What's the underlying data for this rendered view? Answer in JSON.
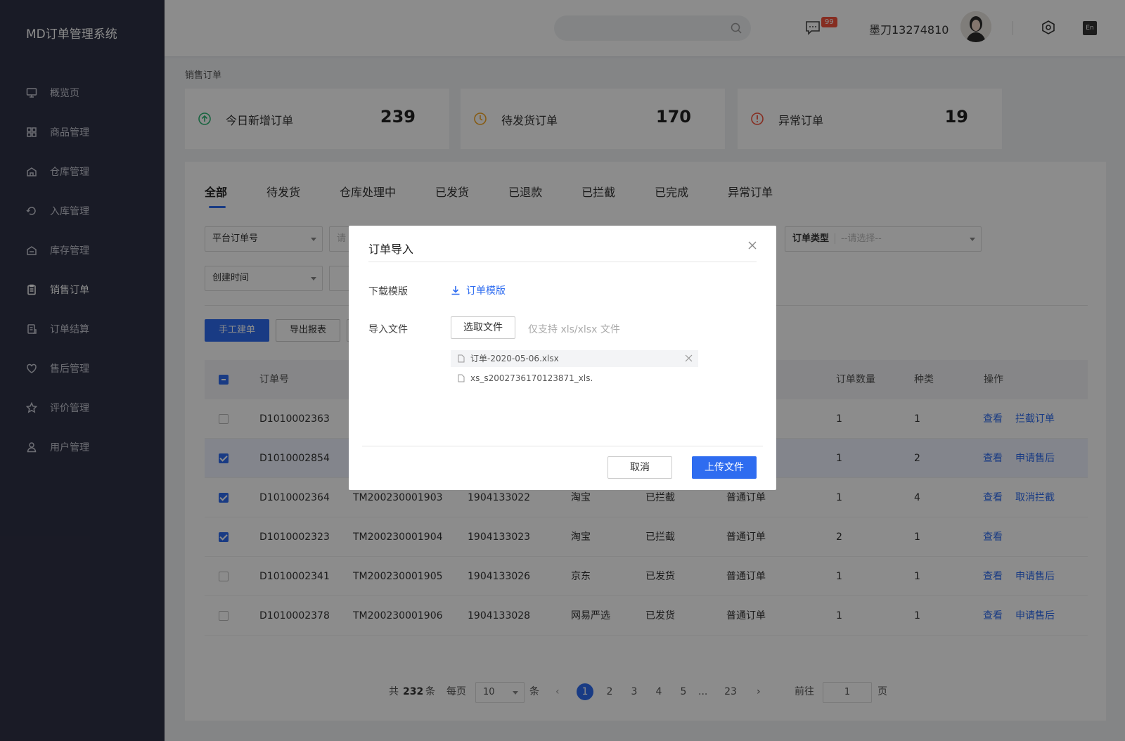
{
  "app": {
    "title": "MD订单管理系统"
  },
  "sidebar": {
    "items": [
      {
        "label": "概览页",
        "icon": "monitor-icon"
      },
      {
        "label": "商品管理",
        "icon": "grid-icon"
      },
      {
        "label": "仓库管理",
        "icon": "warehouse-icon"
      },
      {
        "label": "入库管理",
        "icon": "inbound-icon"
      },
      {
        "label": "库存管理",
        "icon": "stock-icon"
      },
      {
        "label": "销售订单",
        "icon": "clipboard-icon",
        "active": true
      },
      {
        "label": "订单结算",
        "icon": "settlement-icon"
      },
      {
        "label": "售后管理",
        "icon": "heart-icon"
      },
      {
        "label": "评价管理",
        "icon": "star-icon"
      },
      {
        "label": "用户管理",
        "icon": "user-icon"
      }
    ]
  },
  "header": {
    "message_badge": "99",
    "username": "墨刀13274810",
    "lang": "En"
  },
  "breadcrumb": "销售订单",
  "stats": [
    {
      "label": "今日新增订单",
      "value": "239",
      "icon": "arrow-up-circle-icon",
      "color": "#2bb673"
    },
    {
      "label": "待发货订单",
      "value": "170",
      "icon": "clock-icon",
      "color": "#f5a623"
    },
    {
      "label": "异常订单",
      "value": "19",
      "icon": "alert-circle-icon",
      "color": "#f5523c"
    }
  ],
  "tabs": [
    "全部",
    "待发货",
    "仓库处理中",
    "已发货",
    "已退款",
    "已拦截",
    "已完成",
    "异常订单"
  ],
  "filters": {
    "platform_order": "平台订单号",
    "placeholder_partial": "请",
    "create_time": "创建时间",
    "order_type_label": "订单类型",
    "order_type_placeholder": "--请选择--"
  },
  "actions": {
    "manual_create": "手工建单",
    "export_report": "导出报表"
  },
  "table": {
    "headers": {
      "order_no": "订单号",
      "quantity": "订单数量",
      "kind": "种类",
      "ops": "操作"
    },
    "rows": [
      {
        "checked": false,
        "order_no": "D1010002363",
        "tm": "",
        "code": "",
        "platform": "",
        "status": "",
        "type": "",
        "qty": "1",
        "kind": "1",
        "op1": "查看",
        "op2": "拦截订单"
      },
      {
        "checked": true,
        "order_no": "D1010002854",
        "tm": "",
        "code": "",
        "platform": "",
        "status": "",
        "type": "",
        "qty": "1",
        "kind": "2",
        "op1": "查看",
        "op2": "申请售后"
      },
      {
        "checked": true,
        "order_no": "D1010002364",
        "tm": "TM200230001903",
        "code": "1904133022",
        "platform": "淘宝",
        "status": "已拦截",
        "type": "普通订单",
        "qty": "1",
        "kind": "4",
        "op1": "查看",
        "op2": "取消拦截"
      },
      {
        "checked": true,
        "order_no": "D1010002323",
        "tm": "TM200230001904",
        "code": "1904133023",
        "platform": "淘宝",
        "status": "已拦截",
        "type": "普通订单",
        "qty": "2",
        "kind": "1",
        "op1": "查看",
        "op2": ""
      },
      {
        "checked": false,
        "order_no": "D1010002341",
        "tm": "TM200230001905",
        "code": "1904133026",
        "platform": "京东",
        "status": "已发货",
        "type": "普通订单",
        "qty": "1",
        "kind": "1",
        "op1": "查看",
        "op2": "申请售后"
      },
      {
        "checked": false,
        "order_no": "D1010002378",
        "tm": "TM200230001906",
        "code": "1904133028",
        "platform": "网易严选",
        "status": "已发货",
        "type": "普通订单",
        "qty": "1",
        "kind": "1",
        "op1": "查看",
        "op2": "申请售后"
      }
    ]
  },
  "pagination": {
    "total_prefix": "共",
    "total": "232",
    "total_suffix": "条",
    "per_page_label": "每页",
    "per_page": "10",
    "per_page_unit": "条",
    "pages": [
      "1",
      "2",
      "3",
      "4",
      "5"
    ],
    "ellipsis": "...",
    "last": "23",
    "goto_label": "前往",
    "goto_value": "1",
    "goto_unit": "页"
  },
  "modal": {
    "title": "订单导入",
    "download_label": "下载模版",
    "download_link": "订单模版",
    "import_label": "导入文件",
    "select_file": "选取文件",
    "hint": "仅支持 xls/xlsx 文件",
    "files": [
      "订单-2020-05-06.xlsx",
      "xs_s2002736170123871_xls."
    ],
    "cancel": "取消",
    "upload": "上传文件"
  }
}
